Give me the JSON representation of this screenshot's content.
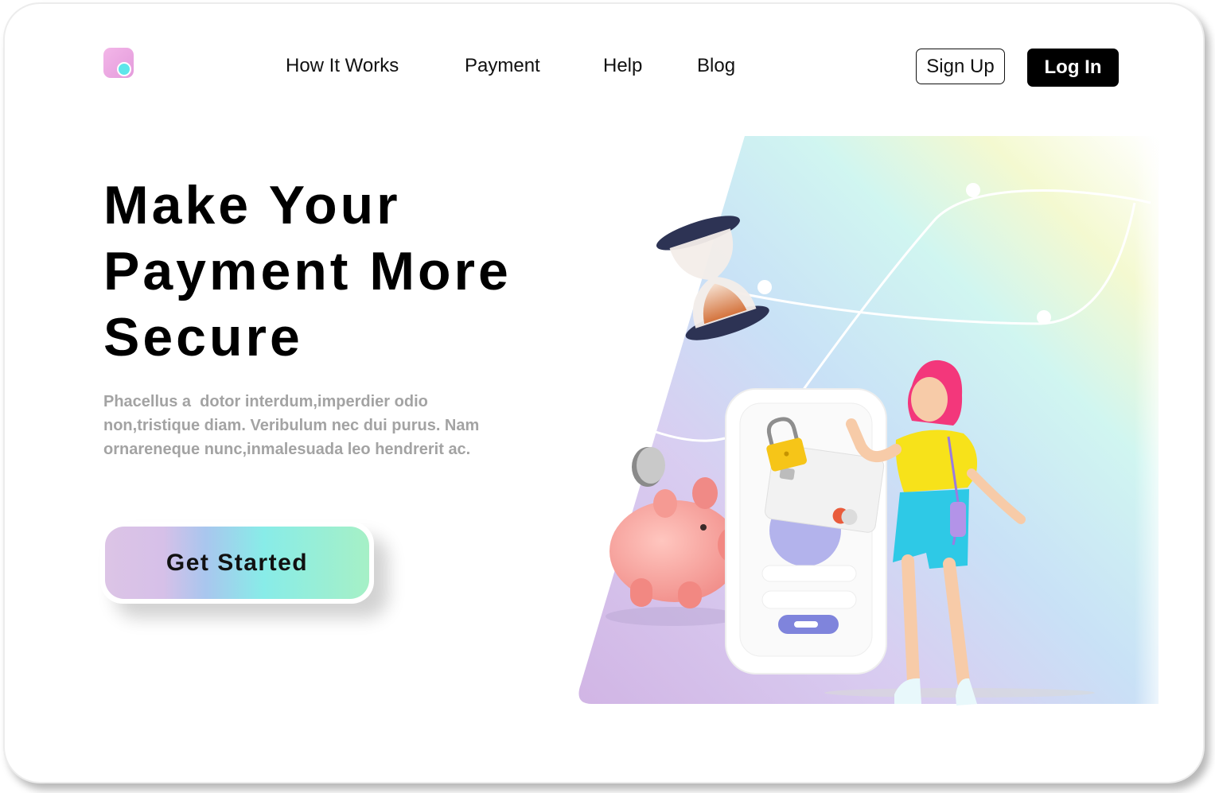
{
  "nav": {
    "links": [
      "How It Works",
      "Payment",
      "Help",
      "Blog"
    ],
    "signup_label": "Sign Up",
    "login_label": "Log In"
  },
  "hero": {
    "headline_lines": [
      "Make Your",
      "Payment More",
      "Secure"
    ],
    "description_lines": [
      "Phacellus a  dotor interdum,imperdier odio",
      "non,tristique diam. Veribulum nec dui purus. Nam",
      "ornareneque nunc,inmalesuada leo hendrerit ac."
    ],
    "cta_label": "Get Started"
  },
  "colors": {
    "accent_pink": "#f3b6e8",
    "accent_cyan": "#5ee6ea",
    "button_dark": "#000000",
    "text_muted": "#a3a3a3"
  },
  "icons": {
    "logo": "app-logo-icon",
    "hourglass": "hourglass-icon",
    "coin": "coin-icon",
    "piggy_bank": "piggy-bank-icon",
    "phone": "smartphone-icon",
    "card": "credit-card-icon",
    "padlock": "padlock-icon"
  }
}
